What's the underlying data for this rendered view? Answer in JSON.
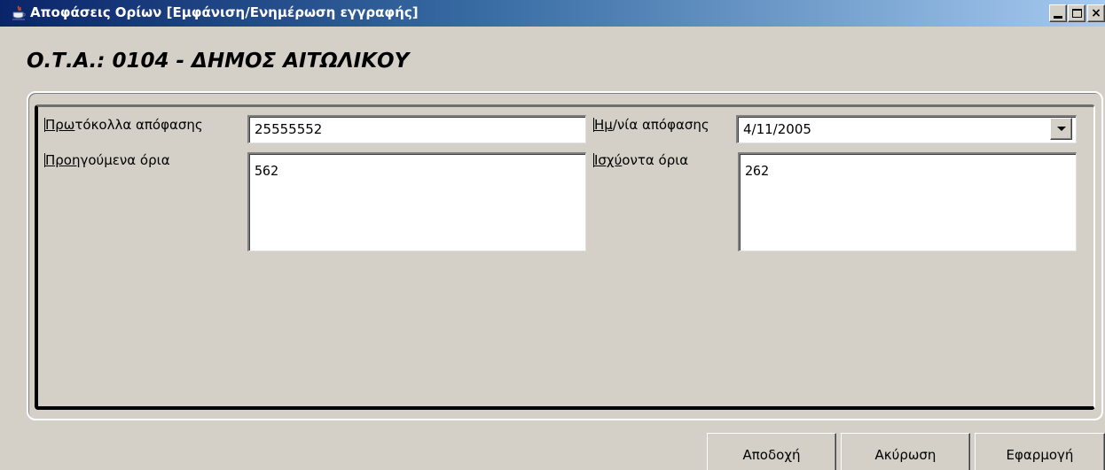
{
  "window": {
    "title": "Αποφάσεις Ορίων [Εμφάνιση/Ενημέρωση  εγγραφής]",
    "icon": "java-cup-icon",
    "controls": {
      "minimize": "_",
      "maximize": "□",
      "close": "×"
    }
  },
  "heading": "Ο.Τ.Α.: 0104 - ΔΗΜΟΣ ΑΙΤΩΛΙΚΟΥ",
  "form": {
    "protocol": {
      "label_mnemonic": "Πρω",
      "label_rest": "τόκολλα απόφασης",
      "value": "25555552"
    },
    "date": {
      "label_mnemonic": "Ημ",
      "label_rest": "/νία απόφασης",
      "value": "4/11/2005"
    },
    "previous_limits": {
      "label_mnemonic": "Προη",
      "label_rest": "γούμενα όρια",
      "value": "562"
    },
    "current_limits": {
      "label_mnemonic": "Ισχύ",
      "label_rest": "οντα όρια",
      "value": "262"
    }
  },
  "buttons": {
    "accept": "Αποδοχή",
    "cancel": "Ακύρωση",
    "apply": "Εφαρμογή"
  }
}
